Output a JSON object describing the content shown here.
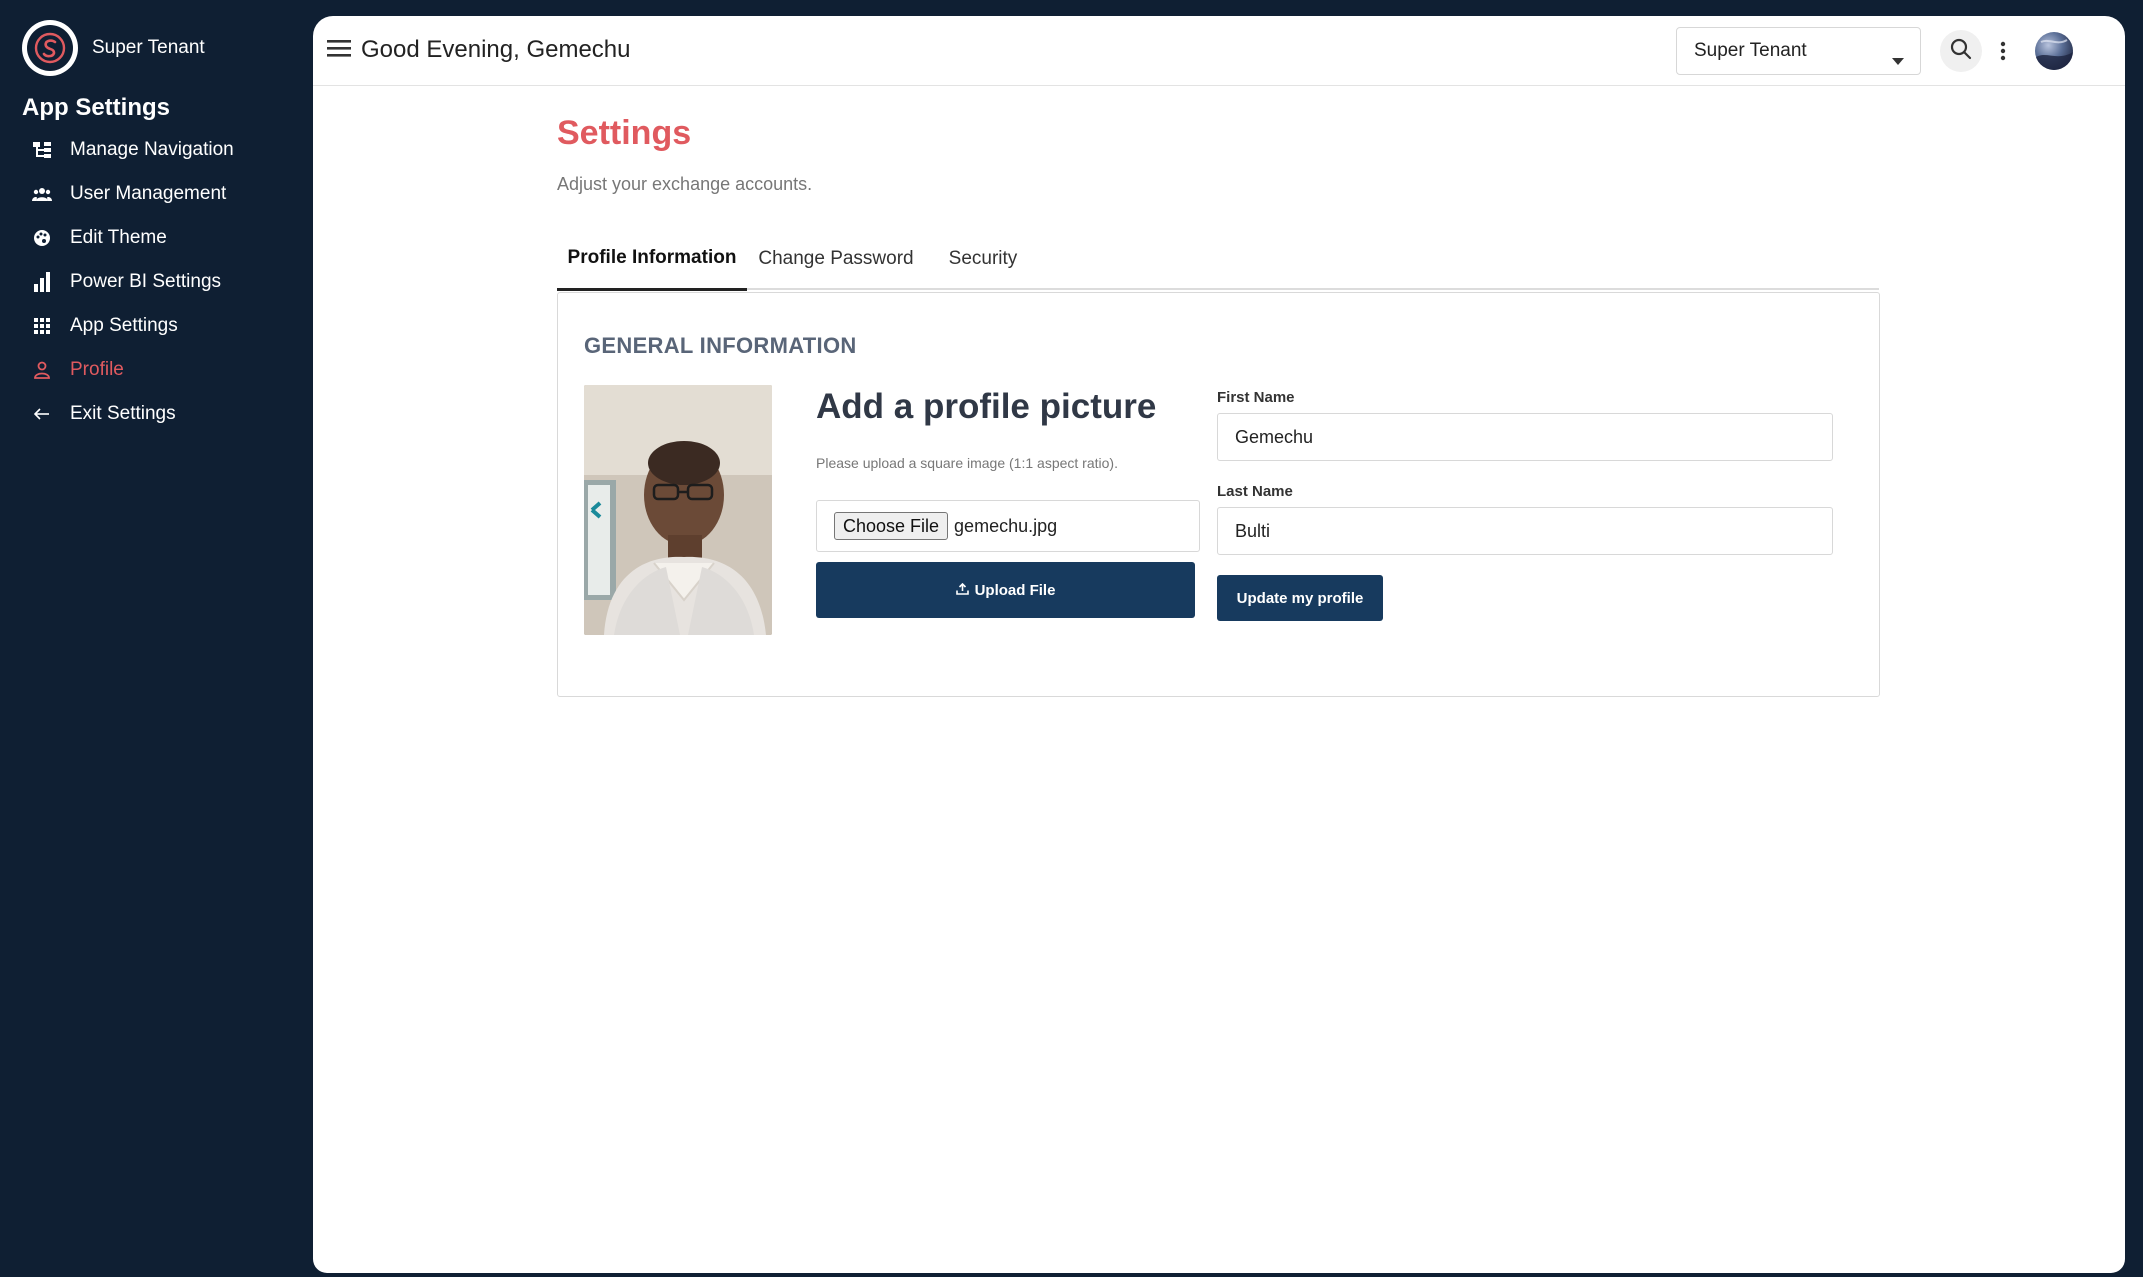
{
  "brand": {
    "name": "Super Tenant",
    "logo_icon": "tenant-logo-icon",
    "accent": "#e05a5f"
  },
  "sidebar": {
    "heading": "App Settings",
    "items": [
      {
        "label": "Manage Navigation",
        "icon": "sitemap-icon",
        "active": false
      },
      {
        "label": "User Management",
        "icon": "users-icon",
        "active": false
      },
      {
        "label": "Edit Theme",
        "icon": "palette-icon",
        "active": false
      },
      {
        "label": "Power BI Settings",
        "icon": "bar-chart-icon",
        "active": false
      },
      {
        "label": "App Settings",
        "icon": "grid-icon",
        "active": false
      },
      {
        "label": "Profile",
        "icon": "person-icon",
        "active": true
      },
      {
        "label": "Exit Settings",
        "icon": "arrow-left-icon",
        "active": false
      }
    ]
  },
  "header": {
    "greeting": "Good Evening, Gemechu",
    "tenant_selected": "Super Tenant"
  },
  "page": {
    "title": "Settings",
    "subtitle": "Adjust your exchange accounts."
  },
  "tabs": [
    {
      "label": "Profile Information",
      "active": true
    },
    {
      "label": "Change Password",
      "active": false
    },
    {
      "label": "Security",
      "active": false
    }
  ],
  "profile": {
    "section_heading": "GENERAL INFORMATION",
    "add_picture_title": "Add a profile picture",
    "add_picture_note": "Please upload a square image (1:1 aspect ratio).",
    "choose_file_label": "Choose File",
    "file_name": "gemechu.jpg",
    "upload_label": "Upload File",
    "first_name_label": "First Name",
    "first_name_value": "Gemechu",
    "last_name_label": "Last Name",
    "last_name_value": "Bulti",
    "update_label": "Update my profile"
  },
  "colors": {
    "sidebar_bg": "#0f1f33",
    "primary_button": "#173a5e",
    "active": "#e05a5f"
  }
}
